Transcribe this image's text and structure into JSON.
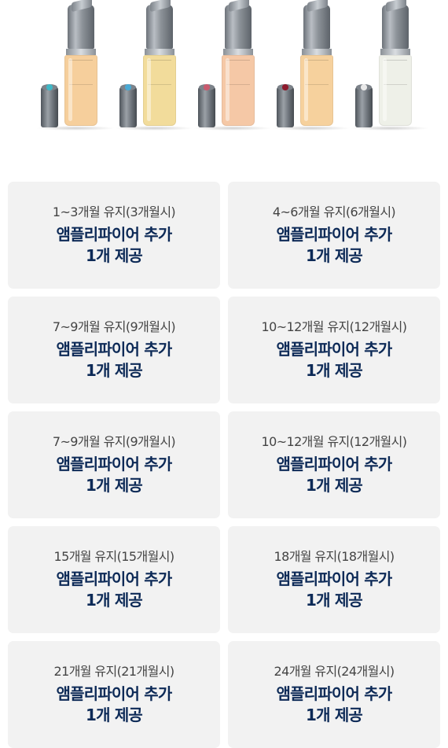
{
  "products": [
    {
      "name": "product-orange",
      "liquid": "#f6cf9c",
      "gem": "#3fb7c6"
    },
    {
      "name": "product-yellow",
      "liquid": "#f2dc9b",
      "gem": "#49a9d4"
    },
    {
      "name": "product-peach",
      "liquid": "#f5c8a6",
      "gem": "#c95a6e"
    },
    {
      "name": "product-apricot",
      "liquid": "#f6d19d",
      "gem": "#8d1a2c"
    },
    {
      "name": "product-clear",
      "liquid": "#eef0e8",
      "gem": "#e9e9e9"
    }
  ],
  "cards": [
    {
      "period": "1~3개월 유지(3개월시)",
      "line1": "앰플리파이어 추가",
      "line2": "1개 제공"
    },
    {
      "period": "4~6개월 유지(6개월시)",
      "line1": "앰플리파이어 추가",
      "line2": "1개 제공"
    },
    {
      "period": "7~9개월 유지(9개월시)",
      "line1": "앰플리파이어 추가",
      "line2": "1개 제공"
    },
    {
      "period": "10~12개월 유지(12개월시)",
      "line1": "앰플리파이어 추가",
      "line2": "1개 제공"
    },
    {
      "period": "7~9개월 유지(9개월시)",
      "line1": "앰플리파이어 추가",
      "line2": "1개 제공"
    },
    {
      "period": "10~12개월 유지(12개월시)",
      "line1": "앰플리파이어 추가",
      "line2": "1개 제공"
    },
    {
      "period": "15개월 유지(15개월시)",
      "line1": "앰플리파이어 추가",
      "line2": "1개 제공"
    },
    {
      "period": "18개월 유지(18개월시)",
      "line1": "앰플리파이어 추가",
      "line2": "1개 제공"
    },
    {
      "period": "21개월 유지(21개월시)",
      "line1": "앰플리파이어 추가",
      "line2": "1개 제공"
    },
    {
      "period": "24개월 유지(24개월시)",
      "line1": "앰플리파이어 추가",
      "line2": "1개 제공"
    }
  ],
  "colors": {
    "card_bg": "#f2f2f2",
    "benefit_text": "#0d2a57",
    "period_text": "#444444"
  }
}
